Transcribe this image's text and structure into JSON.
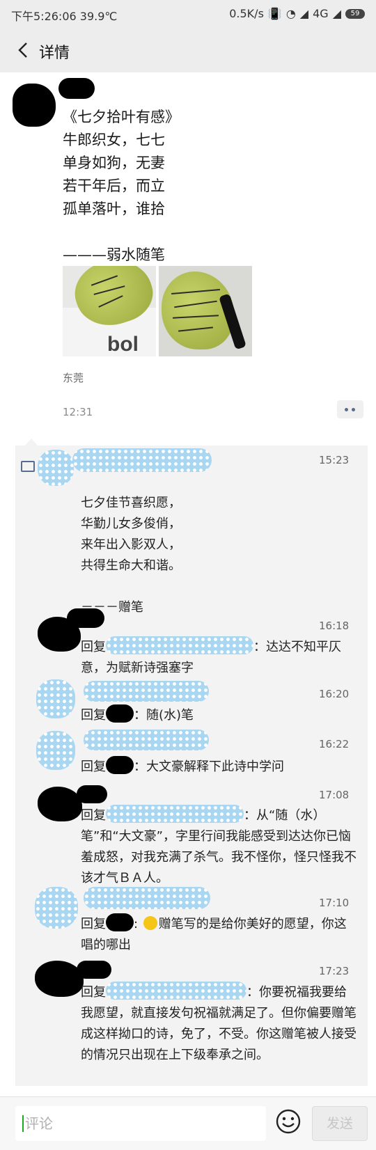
{
  "status_bar": {
    "left": "下午5:26:06 39.9℃",
    "speed": "0.5K/s",
    "network": "4G",
    "battery": "59"
  },
  "header": {
    "title": "详情"
  },
  "post": {
    "text": "《七夕拾叶有感》\n牛郎织女，七七\n单身如狗，无妻\n若干年后，而立\n孤单落叶，谁拾\n\n———弱水随笔",
    "location": "东莞",
    "time": "12:31"
  },
  "comments": [
    {
      "time": "15:23",
      "text": "七夕佳节喜织愿，\n华勤儿女多俊俏，\n来年出入影双人，\n共得生命大和谐。\n\n－－－赠笔"
    },
    {
      "time": "16:18",
      "reply_prefix": "回复",
      "text": "：达达不知平仄意，为赋新诗强塞字"
    },
    {
      "time": "16:20",
      "reply_prefix": "回复",
      "text": "：随(水)笔"
    },
    {
      "time": "16:22",
      "reply_prefix": "回复",
      "text": "：大文豪解释下此诗中学问"
    },
    {
      "time": "17:08",
      "reply_prefix": "回复",
      "text": "：从“随（水）笔”和“大文豪”，字里行间我能感受到达达你已恼羞成怒，对我充满了杀气。我不怪你，怪只怪我不该才气ＢＡ人。"
    },
    {
      "time": "17:10",
      "reply_prefix": "回复",
      "text": "赠笔写的是给你美好的愿望，你这唱的哪出"
    },
    {
      "time": "17:23",
      "reply_prefix": "回复",
      "text": "：你要祝福我要给我愿望，就直接发句祝福就满足了。但你偏要赠笔成这样拗口的诗，免了，不受。你这赠笔被人接受的情况只出现在上下级奉承之间。"
    }
  ],
  "bottom_bar": {
    "placeholder": "评论",
    "send_label": "发送"
  },
  "colors": {
    "accent_link": "#5a6b8c",
    "mosaic": "#a9d6f1",
    "cursor": "#1aad19"
  }
}
